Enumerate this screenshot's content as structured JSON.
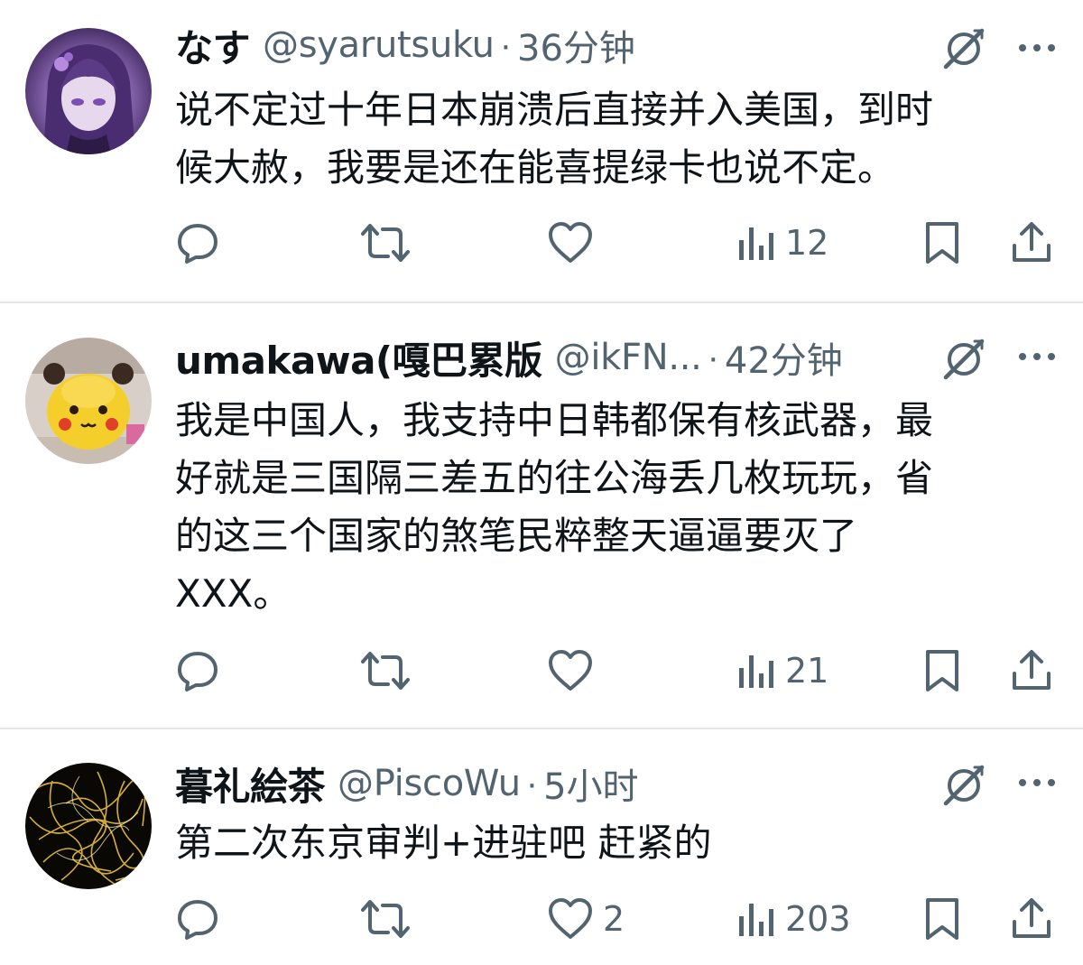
{
  "tweets": [
    {
      "name": "なす",
      "handle": "@syarutsuku",
      "separator": "·",
      "time": "36分钟",
      "lines": [
        "说不定过十年日本崩溃后直接并入美国，到时",
        "候大赦，我要是还在能喜提绿卡也说不定。"
      ],
      "views": "12",
      "likes": "",
      "avatar": "purple-haired-anime-girl"
    },
    {
      "name": "umakawa(嘎巴累版",
      "handle": "@ikFN...",
      "separator": "·",
      "time": "42分钟",
      "lines": [
        "我是中国人，我支持中日韩都保有核武器，最",
        "好就是三国隔三差五的往公海丢几枚玩玩，省",
        "的这三个国家的煞笔民粹整天逼逼要灭了",
        "XXX。"
      ],
      "views": "21",
      "likes": "",
      "avatar": "pikachu-donut"
    },
    {
      "name": "暮礼絵茶",
      "handle": "@PiscoWu",
      "separator": "·",
      "time": "5小时",
      "lines": [
        "第二次东京审判+进驻吧 赶紧的"
      ],
      "views": "203",
      "likes": "2",
      "avatar": "golden-light-trails"
    }
  ],
  "colors": {
    "text": "#0f1419",
    "secondary": "#536471",
    "divider": "#e4e7ea"
  }
}
